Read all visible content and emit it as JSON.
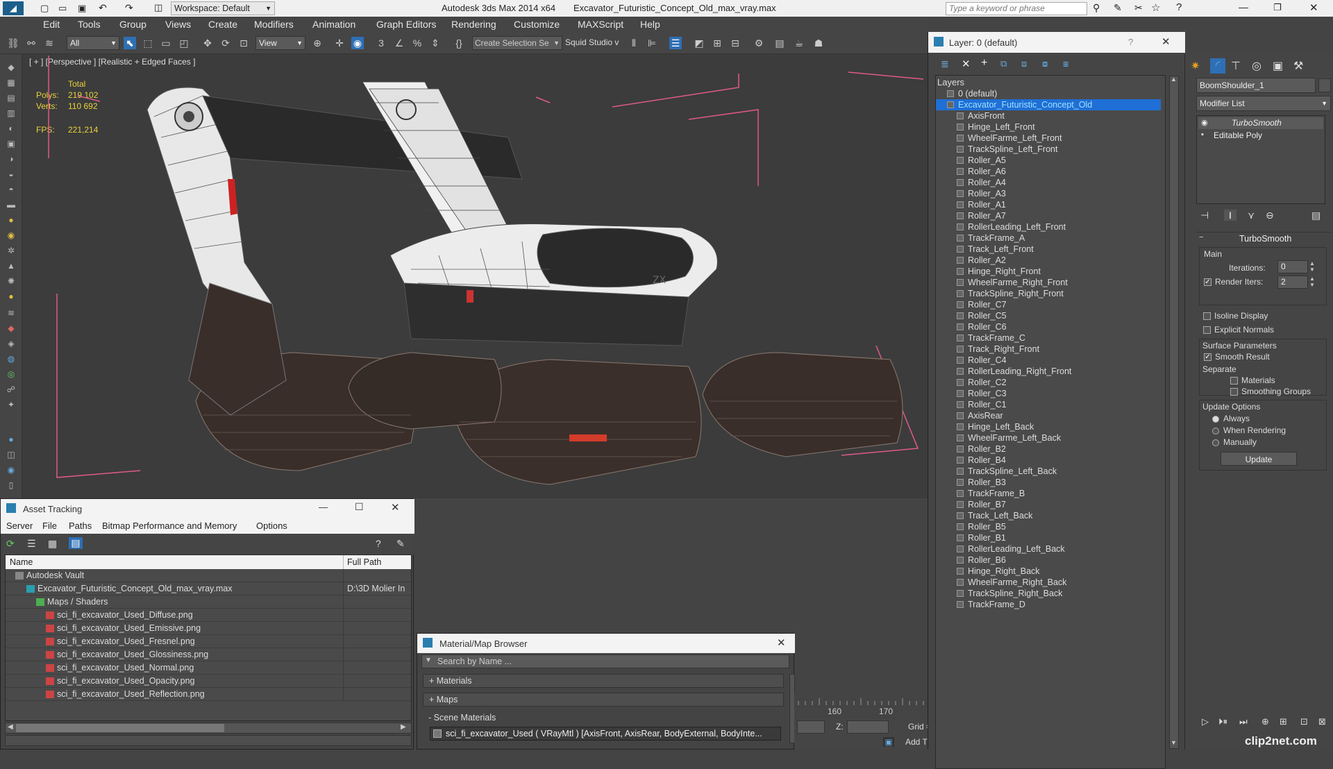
{
  "titlebar": {
    "workspace_label": "Workspace: Default",
    "app_title": "Autodesk 3ds Max  2014 x64",
    "file_title": "Excavator_Futuristic_Concept_Old_max_vray.max",
    "search_placeholder": "Type a keyword or phrase"
  },
  "menu": [
    "Edit",
    "Tools",
    "Group",
    "Views",
    "Create",
    "Modifiers",
    "Animation",
    "Graph Editors",
    "Rendering",
    "Customize",
    "MAXScript",
    "Help"
  ],
  "toolbar": {
    "filter_value": "All",
    "refcoord_value": "View",
    "selection_set_placeholder": "Create Selection Se",
    "squid_label": "Squid Studio v"
  },
  "viewport": {
    "label": "[ + ] [Perspective ] [Realistic + Edged Faces ]",
    "stats_total": "Total",
    "polys_label": "Polys:",
    "polys_value": "219 102",
    "verts_label": "Verts:",
    "verts_value": "110 692",
    "fps_label": "FPS:",
    "fps_value": "221,214"
  },
  "layers": {
    "title": "Layer: 0 (default)",
    "help": "?",
    "list_label": "Layers",
    "items": [
      "0 (default)",
      "Excavator_Futuristic_Concept_Old",
      "AxisFront",
      "Hinge_Left_Front",
      "WheelFarme_Left_Front",
      "TrackSpline_Left_Front",
      "Roller_A5",
      "Roller_A6",
      "Roller_A4",
      "Roller_A3",
      "Roller_A1",
      "Roller_A7",
      "RollerLeading_Left_Front",
      "TrackFrame_A",
      "Track_Left_Front",
      "Roller_A2",
      "Hinge_Right_Front",
      "WheelFarme_Right_Front",
      "TrackSpline_Right_Front",
      "Roller_C7",
      "Roller_C5",
      "Roller_C6",
      "TrackFrame_C",
      "Track_Right_Front",
      "Roller_C4",
      "RollerLeading_Right_Front",
      "Roller_C2",
      "Roller_C3",
      "Roller_C1",
      "AxisRear",
      "Hinge_Left_Back",
      "WheelFarme_Left_Back",
      "Roller_B2",
      "Roller_B4",
      "TrackSpline_Left_Back",
      "Roller_B3",
      "TrackFrame_B",
      "Roller_B7",
      "Track_Left_Back",
      "Roller_B5",
      "Roller_B1",
      "RollerLeading_Left_Back",
      "Roller_B6",
      "Hinge_Right_Back",
      "WheelFarme_Right_Back",
      "TrackSpline_Right_Back",
      "TrackFrame_D"
    ]
  },
  "command": {
    "object_name": "BoomShoulder_1",
    "modifier_list": "Modifier List",
    "stack": [
      "TurboSmooth",
      "Editable Poly"
    ],
    "rollout_title": "TurboSmooth",
    "main_label": "Main",
    "iterations_label": "Iterations:",
    "iterations_value": "0",
    "render_iters_label": "Render Iters:",
    "render_iters_value": "2",
    "isoline_label": "Isoline Display",
    "explicit_normals_label": "Explicit Normals",
    "surface_params_label": "Surface Parameters",
    "smooth_result_label": "Smooth Result",
    "separate_label": "Separate",
    "materials_label": "Materials",
    "smoothing_groups_label": "Smoothing Groups",
    "update_options_label": "Update Options",
    "always_label": "Always",
    "when_rendering_label": "When Rendering",
    "manually_label": "Manually",
    "update_button": "Update"
  },
  "asset": {
    "title": "Asset Tracking",
    "menu": [
      "Server",
      "File",
      "Paths",
      "Bitmap Performance and Memory",
      "Options"
    ],
    "col_name": "Name",
    "col_path": "Full Path",
    "rows": [
      {
        "name": "Autodesk Vault",
        "path": ""
      },
      {
        "name": "Excavator_Futuristic_Concept_Old_max_vray.max",
        "path": "D:\\3D Molier In"
      },
      {
        "name": "Maps / Shaders",
        "path": ""
      },
      {
        "name": "sci_fi_excavator_Used_Diffuse.png",
        "path": ""
      },
      {
        "name": "sci_fi_excavator_Used_Emissive.png",
        "path": ""
      },
      {
        "name": "sci_fi_excavator_Used_Fresnel.png",
        "path": ""
      },
      {
        "name": "sci_fi_excavator_Used_Glossiness.png",
        "path": ""
      },
      {
        "name": "sci_fi_excavator_Used_Normal.png",
        "path": ""
      },
      {
        "name": "sci_fi_excavator_Used_Opacity.png",
        "path": ""
      },
      {
        "name": "sci_fi_excavator_Used_Reflection.png",
        "path": ""
      }
    ]
  },
  "material": {
    "title": "Material/Map Browser",
    "search_placeholder": "Search by Name ...",
    "sections": [
      "+ Materials",
      "+ Maps",
      "- Scene Materials"
    ],
    "scene_item": "sci_fi_excavator_Used  ( VRayMtl ) [AxisFront, AxisRear, BodyExternal, BodyInte..."
  },
  "timeline": {
    "ticks": [
      "160",
      "170"
    ],
    "z_label": "Z:",
    "grid_label": "Grid =",
    "add_time_label": "Add T"
  },
  "watermark": "clip2net.com",
  "colors": {
    "accent": "#1f6fd6",
    "stats": "#e8d23a",
    "panel": "#454545"
  }
}
